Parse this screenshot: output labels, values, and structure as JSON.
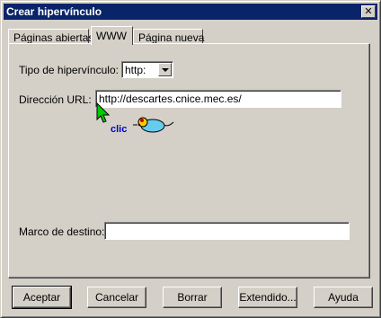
{
  "window": {
    "title": "Crear hipervínculo",
    "close_glyph": "✕"
  },
  "tabs": [
    {
      "label": "Páginas abiertas",
      "active": false
    },
    {
      "label": "WWW",
      "active": true
    },
    {
      "label": "Página nueva",
      "active": false
    }
  ],
  "form": {
    "link_type_label": "Tipo de hipervínculo:",
    "link_type_value": "http:",
    "url_label": "Dirección URL:",
    "url_value": "http://descartes.cnice.mec.es/",
    "target_label": "Marco de destino:",
    "target_value": ""
  },
  "annotation": {
    "click_text": "clic"
  },
  "buttons": {
    "accept": "Aceptar",
    "cancel": "Cancelar",
    "clear": "Borrar",
    "extended": "Extendido...",
    "help": "Ayuda"
  },
  "colors": {
    "title_bar": "#0a246a",
    "dialog_bg": "#d4d0c8",
    "cursor": "#00cc00",
    "click_label": "#0000cc"
  }
}
